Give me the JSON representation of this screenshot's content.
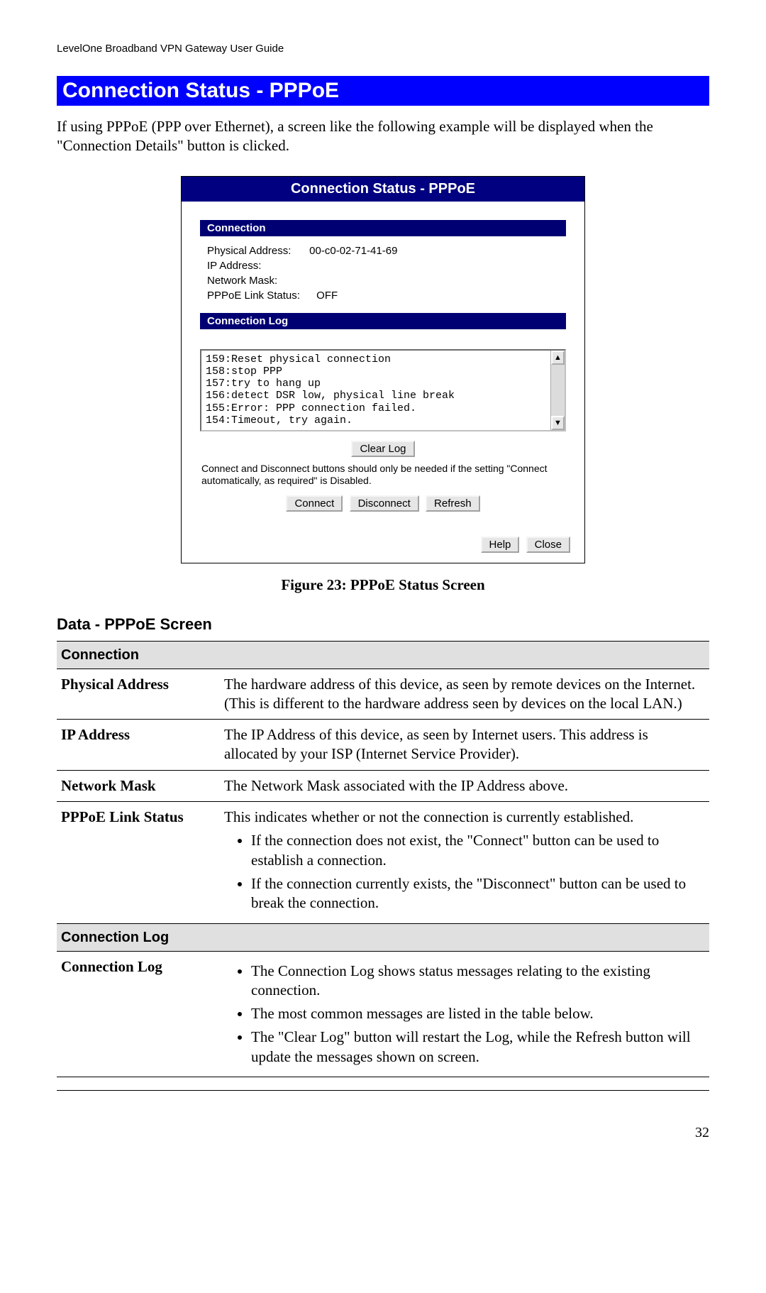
{
  "header": "LevelOne Broadband VPN Gateway User Guide",
  "sectionHeading": "Connection Status - PPPoE",
  "intro": "If using PPPoE (PPP over Ethernet), a screen like the following example will be displayed when the \"Connection Details\" button is clicked.",
  "screenshot": {
    "title": "Connection Status - PPPoE",
    "connectionHeader": "Connection",
    "rows": {
      "physAddrLabel": "Physical Address:",
      "physAddrValue": "00-c0-02-71-41-69",
      "ipLabel": "IP Address:",
      "ipValue": "",
      "maskLabel": "Network Mask:",
      "maskValue": "",
      "linkLabel": "PPPoE Link Status:",
      "linkValue": "OFF"
    },
    "logHeader": "Connection Log",
    "logText": "159:Reset physical connection\n158:stop PPP\n157:try to hang up\n156:detect DSR low, physical line break\n155:Error: PPP connection failed.\n154:Timeout, try again.",
    "clearLog": "Clear Log",
    "hint": "Connect and Disconnect buttons should only be needed if the setting \"Connect automatically, as required\" is Disabled.",
    "connect": "Connect",
    "disconnect": "Disconnect",
    "refresh": "Refresh",
    "help": "Help",
    "close": "Close"
  },
  "figureCaption": "Figure 23: PPPoE Status Screen",
  "dataHeading": "Data - PPPoE Screen",
  "table": {
    "group1": "Connection",
    "r1Label": "Physical Address",
    "r1Desc": "The hardware address of this device, as seen by remote devices on the Internet. (This is different to the hardware address seen by devices on the local LAN.)",
    "r2Label": "IP Address",
    "r2Desc": "The IP Address of this device, as seen by Internet users. This address is allocated by your ISP (Internet Service Provider).",
    "r3Label": "Network Mask",
    "r3Desc": "The Network Mask associated with the IP Address above.",
    "r4Label": "PPPoE Link Status",
    "r4Desc": "This indicates whether or not the connection is currently established.",
    "r4b1": "If the connection does not exist, the \"Connect\" button can be used to establish a connection.",
    "r4b2": "If the connection currently exists, the \"Disconnect\" button can be used to break the connection.",
    "group2": "Connection Log",
    "r5Label": "Connection Log",
    "r5b1": "The Connection Log shows status messages relating to the existing connection.",
    "r5b2": "The most common messages are listed in the table below.",
    "r5b3": "The \"Clear Log\" button will restart the Log, while the Refresh button will update the messages shown on screen."
  },
  "pageNumber": "32"
}
